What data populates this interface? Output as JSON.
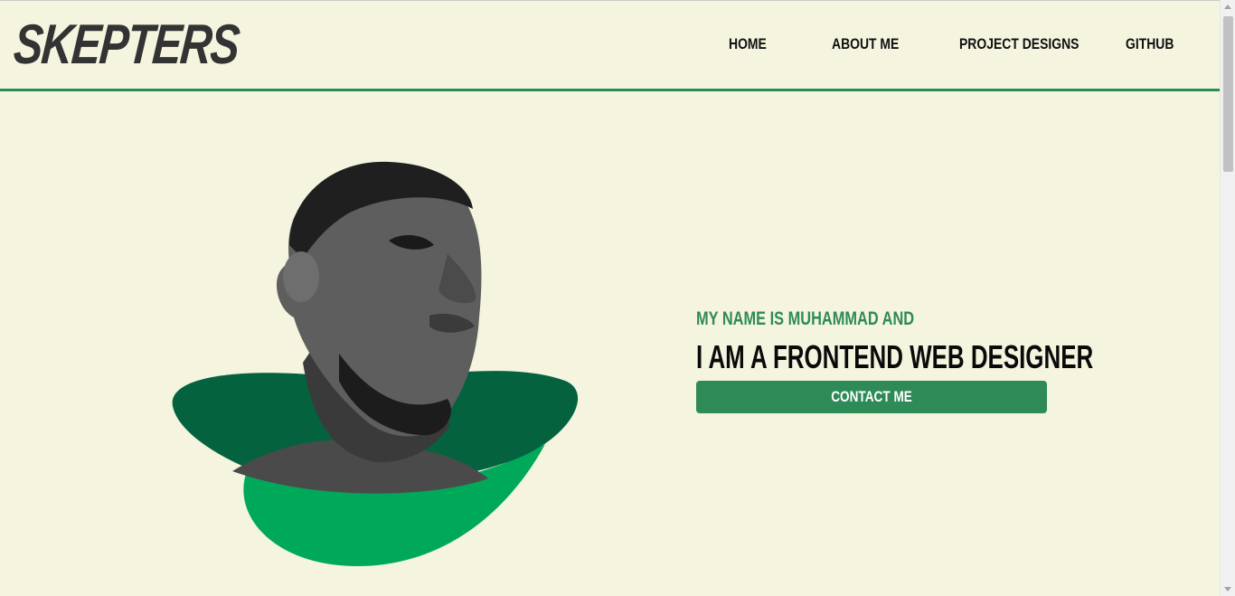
{
  "header": {
    "logo": "SKEPTERS",
    "nav": [
      {
        "label": "HOME"
      },
      {
        "label": "ABOUT ME"
      },
      {
        "label": "PROJECT DESIGNS"
      },
      {
        "label": "GITHUB"
      }
    ]
  },
  "hero": {
    "intro": "MY NAME IS MUHAMMAD AND",
    "headline": "I AM A FRONTEND WEB DESIGNER",
    "cta_label": "CONTACT ME",
    "image_icon": "portrait-photo-grayscale"
  },
  "colors": {
    "background": "#f4f4df",
    "accent_green": "#2e8b57",
    "dark_green": "#05623f",
    "bright_green": "#00a859",
    "text_dark": "#111111"
  }
}
